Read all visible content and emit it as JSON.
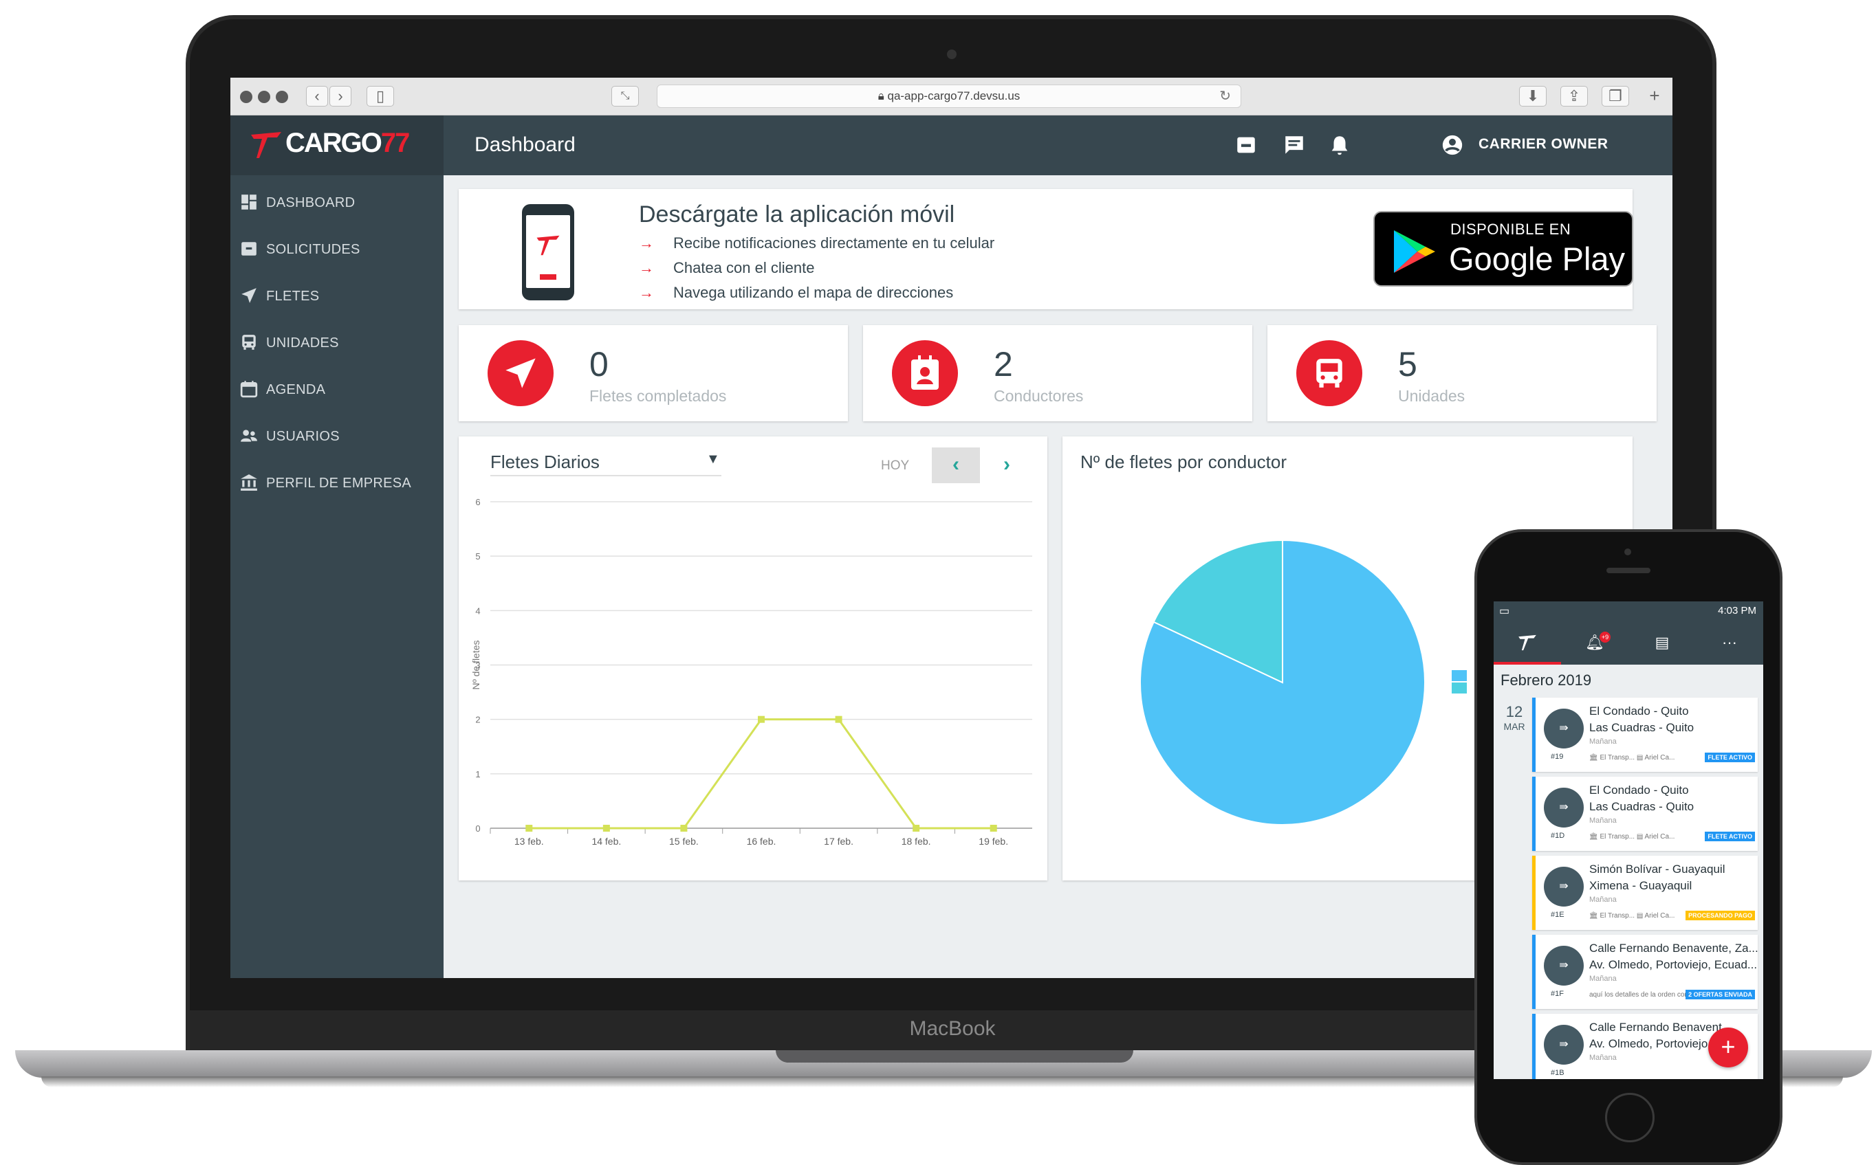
{
  "browser": {
    "url": "qa-app-cargo77.devsu.us"
  },
  "brand": {
    "logo_text_main": "CARGO",
    "logo_text_accent": "77",
    "accent_color": "#e8202f",
    "sidebar_color": "#37474f"
  },
  "header": {
    "title": "Dashboard",
    "icons": [
      "archive-icon",
      "chat-icon",
      "bell-icon"
    ],
    "user_label": "CARRIER OWNER"
  },
  "sidebar": {
    "items": [
      {
        "label": "DASHBOARD",
        "icon": "dashboard-icon"
      },
      {
        "label": "SOLICITUDES",
        "icon": "inbox-icon"
      },
      {
        "label": "FLETES",
        "icon": "send-icon"
      },
      {
        "label": "UNIDADES",
        "icon": "bus-icon"
      },
      {
        "label": "AGENDA",
        "icon": "calendar-icon"
      },
      {
        "label": "USUARIOS",
        "icon": "users-icon"
      },
      {
        "label": "PERFIL DE EMPRESA",
        "icon": "bank-icon"
      }
    ]
  },
  "banner": {
    "title": "Descárgate la aplicación móvil",
    "bullets": [
      "Recibe notificaciones directamente en tu celular",
      "Chatea con el cliente",
      "Navega utilizando el mapa de direcciones"
    ],
    "store_line1": "DISPONIBLE EN",
    "store_line2": "Google Play"
  },
  "stats": [
    {
      "value": "0",
      "label": "Fletes completados",
      "icon": "send-icon"
    },
    {
      "value": "2",
      "label": "Conductores",
      "icon": "contact-icon"
    },
    {
      "value": "5",
      "label": "Unidades",
      "icon": "bus-icon"
    }
  ],
  "daily_chart": {
    "selector": "Fletes Diarios",
    "today_label": "HOY",
    "prev_icon": "chevron-left-icon",
    "next_icon": "chevron-right-icon"
  },
  "pie_chart": {
    "title": "Nº de fletes por conductor"
  },
  "chart_data": [
    {
      "type": "line",
      "title": "",
      "xlabel": "",
      "ylabel": "Nº de fletes",
      "categories": [
        "13 feb.",
        "14 feb.",
        "15 feb.",
        "16 feb.",
        "17 feb.",
        "18 feb.",
        "19 feb."
      ],
      "values": [
        0,
        0,
        0,
        2,
        2,
        0,
        0
      ],
      "yticks": [
        0,
        1,
        2,
        3,
        4,
        5,
        6
      ],
      "ylim": [
        0,
        6
      ],
      "grid": true,
      "line_color": "#d4e157"
    },
    {
      "type": "pie",
      "title": "Nº de fletes por conductor",
      "slices": [
        {
          "value": 82,
          "color": "#4fc3f7"
        },
        {
          "value": 18,
          "color": "#4dd0e1"
        }
      ]
    }
  ],
  "laptop_label": "MacBook",
  "phone": {
    "status_time": "4:03 PM",
    "notif_count": "+9",
    "month": "Febrero 2019",
    "day_num": "12",
    "day_month": "MAR",
    "nav_more": "···",
    "fab": "+",
    "items": [
      {
        "line1": "El Condado - Quito",
        "line2": "Las Cuadras - Quito",
        "when": "Mañana",
        "code": "#19",
        "meta": "🏛 El Transp... ▤ Ariel Ca...",
        "tag": "FLETE ACTIVO",
        "style": "blue"
      },
      {
        "line1": "El Condado - Quito",
        "line2": "Las Cuadras - Quito",
        "when": "Mañana",
        "code": "#1D",
        "meta": "🏛 El Transp... ▤ Ariel Ca...",
        "tag": "FLETE ACTIVO",
        "style": "blue"
      },
      {
        "line1": "Simón Bolívar - Guayaquil",
        "line2": "Ximena - Guayaquil",
        "when": "Mañana",
        "code": "#1E",
        "meta": "🏛 El Transp... ▤ Ariel Ca...",
        "tag": "PROCESANDO PAGO",
        "style": "yellow"
      },
      {
        "line1": "Calle Fernando Benavente, Za...",
        "line2": "Av. Olmedo, Portoviejo, Ecuad...",
        "when": "Mañana",
        "code": "#1F",
        "meta": "aquí los detalles de la orden como Lorem ipsum",
        "tag": "2 OFERTAS ENVIADA",
        "style": "blue"
      },
      {
        "line1": "Calle Fernando Benavent...",
        "line2": "Av. Olmedo, Portoviejo,...",
        "when": "Mañana",
        "code": "#1B",
        "meta": "",
        "tag": "",
        "style": "blue"
      }
    ]
  }
}
